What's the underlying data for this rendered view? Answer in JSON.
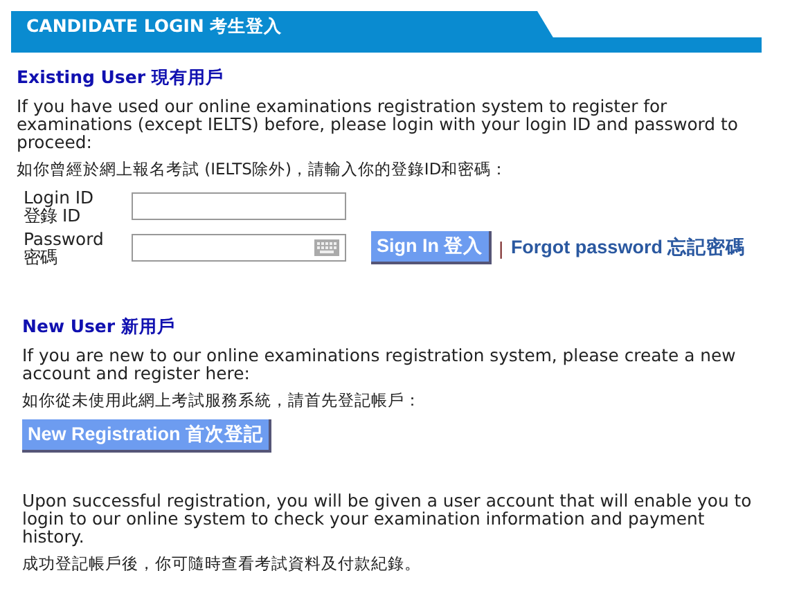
{
  "header": {
    "title": "CANDIDATE LOGIN 考生登入"
  },
  "existing": {
    "heading": "Existing User 現有用戶",
    "text_en": "If you have used our online examinations registration system to register for examinations (except IELTS) before, please login with your login ID and password to proceed:",
    "text_zh": "如你曾經於網上報名考試 (IELTS除外)，請輸入你的登錄ID和密碼：",
    "fields": [
      {
        "kind": "text",
        "label_en": "Login ID",
        "label_zh": "登錄 ID"
      },
      {
        "kind": "password",
        "label_en": "Password",
        "label_zh": "密碼"
      }
    ],
    "sign_in": "Sign In 登入",
    "separator": "|",
    "forgot": "Forgot password 忘記密碼"
  },
  "new_user": {
    "heading": "New User 新用戶",
    "text_en": "If you are new to our online examinations registration system, please create a new account and register here:",
    "text_zh": "如你從未使用此網上考試服務系統，請首先登記帳戶：",
    "button": "New Registration 首次登記"
  },
  "footer": {
    "text_en": "Upon successful registration, you will be given a user account that will enable you to login to our online system to check your examination information and payment history.",
    "text_zh": "成功登記帳戶後，你可隨時查看考試資料及付款紀錄。"
  }
}
